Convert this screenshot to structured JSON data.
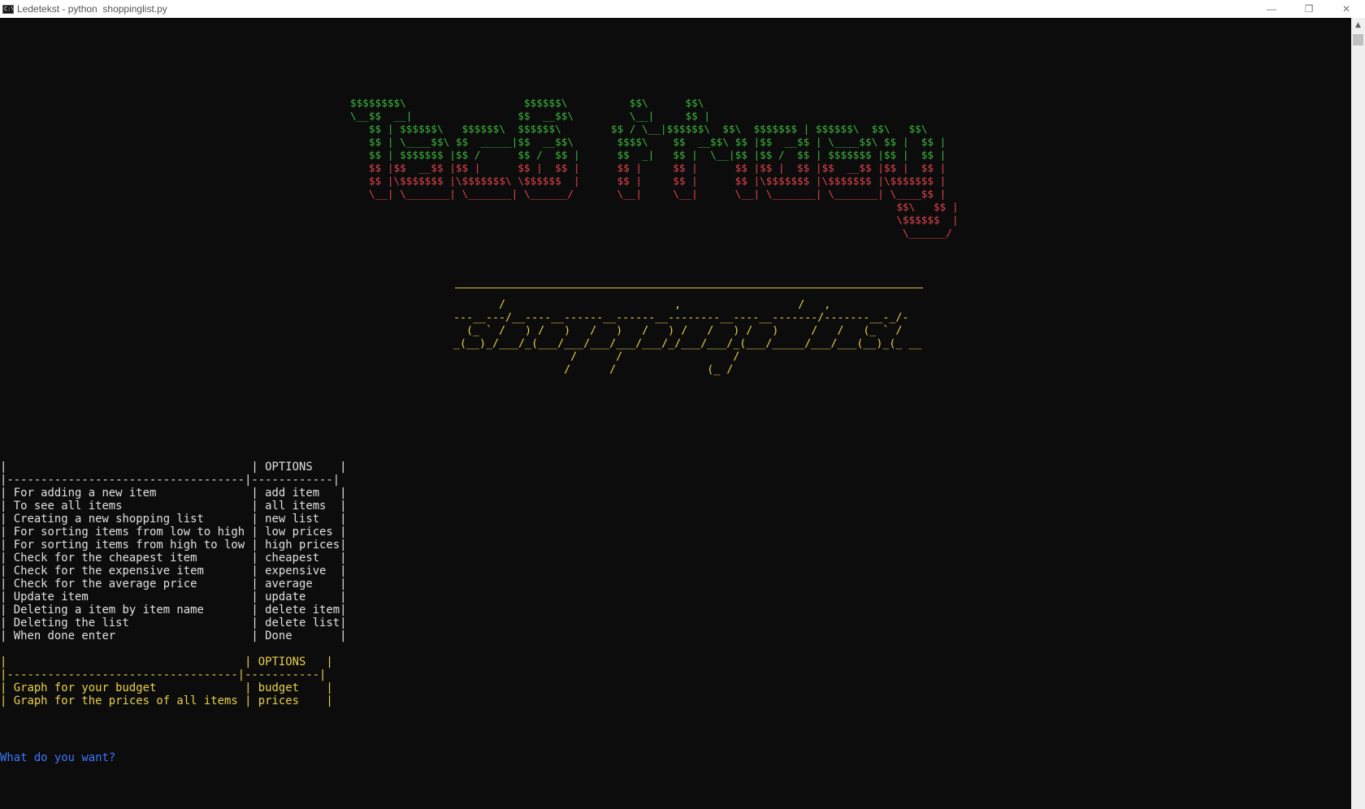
{
  "window": {
    "title": "Ledetekst - python  shoppinglist.py",
    "icon": "cmd-icon",
    "controls": {
      "minimize": "—",
      "restore": "❐",
      "close": "✕"
    }
  },
  "banner": {
    "lines": [
      {
        "color": "green",
        "text": "$$$$$$$$\\                   $$$$$$\\          $$\\      $$\\"
      },
      {
        "color": "green",
        "text": "\\__$$  __|                 $$  __$$\\         \\__|     $$ |"
      },
      {
        "color": "green",
        "text": "   $$ | $$$$$$\\   $$$$$$\\  $$$$$$\\        $$ / \\__|$$$$$$\\  $$\\  $$$$$$$ | $$$$$$\\  $$\\   $$\\"
      },
      {
        "color": "green",
        "text": "   $$ | \\____$$\\ $$  _____|$$  __$$\\       $$$$\\    $$  __$$\\ $$ |$$  __$$ | \\____$$\\ $$ |  $$ |"
      },
      {
        "color": "green",
        "text": "   $$ | $$$$$$$ |$$ /      $$ /  $$ |      $$  _|   $$ |  \\__|$$ |$$ /  $$ | $$$$$$$ |$$ |  $$ |"
      },
      {
        "color": "red",
        "text": "   $$ |$$  __$$ |$$ |      $$ |  $$ |      $$ |     $$ |      $$ |$$ |  $$ |$$  __$$ |$$ |  $$ |"
      },
      {
        "color": "red",
        "text": "   $$ |\\$$$$$$$ |\\$$$$$$$\\ \\$$$$$$  |      $$ |     $$ |      $$ |\\$$$$$$$ |\\$$$$$$$ |\\$$$$$$$ |"
      },
      {
        "color": "red",
        "text": "   \\__| \\_______| \\_______| \\______/       \\__|     \\__|      \\__| \\_______| \\_______| \\____$$ |"
      },
      {
        "color": "red",
        "text": "                                                                                        $$\\   $$ |"
      },
      {
        "color": "red",
        "text": "                                                                                        \\$$$$$$  |"
      },
      {
        "color": "red",
        "text": "                                                                                         \\______/"
      }
    ]
  },
  "fancy_title": {
    "lines": [
      "       /                          ,                  /   ,",
      "---__---/__----__------__------__--------__----__-------/-------__-_/-",
      "  (_ ` /   ) /   )   /   )   /   ) /   /   ) /   )     /   /   (_ ` /",
      "_(__)_/___/_(___/___/___/___/___/_/___/___/_(___/_____/___/___(__)_(_ __",
      "                  /      /                 /",
      "                 /      /              (_ /"
    ]
  },
  "menu": {
    "header_option": "OPTIONS",
    "separator": "|-----------------------------------|------------|",
    "items": [
      {
        "description": "For adding a new item",
        "option": "add item"
      },
      {
        "description": "To see all items",
        "option": "all items"
      },
      {
        "description": "Creating a new shopping list",
        "option": "new list"
      },
      {
        "description": "For sorting items from low to high",
        "option": "low prices"
      },
      {
        "description": "For sorting items from high to low",
        "option": "high prices"
      },
      {
        "description": "Check for the cheapest item",
        "option": "cheapest"
      },
      {
        "description": "Check for the expensive item",
        "option": "expensive"
      },
      {
        "description": "Check for the average price",
        "option": "average"
      },
      {
        "description": "Update item",
        "option": "update"
      },
      {
        "description": "Deleting a item by item name",
        "option": "delete item"
      },
      {
        "description": "Deleting the list",
        "option": "delete list"
      },
      {
        "description": "When done enter",
        "option": "Done"
      }
    ]
  },
  "graph_menu": {
    "header_option": "OPTIONS",
    "separator": "|----------------------------------|-----------|",
    "items": [
      {
        "description": "Graph for your budget",
        "option": "budget"
      },
      {
        "description": "Graph for the prices of all items",
        "option": "prices"
      }
    ]
  },
  "prompt": {
    "text": "What do you want?"
  },
  "colors": {
    "background": "#0c0c0c",
    "banner_green": "#3cb83c",
    "banner_red": "#e0454f",
    "yellow": "#e8d04a",
    "menu_text": "#e0e0e0",
    "prompt_blue": "#3b78ff"
  }
}
